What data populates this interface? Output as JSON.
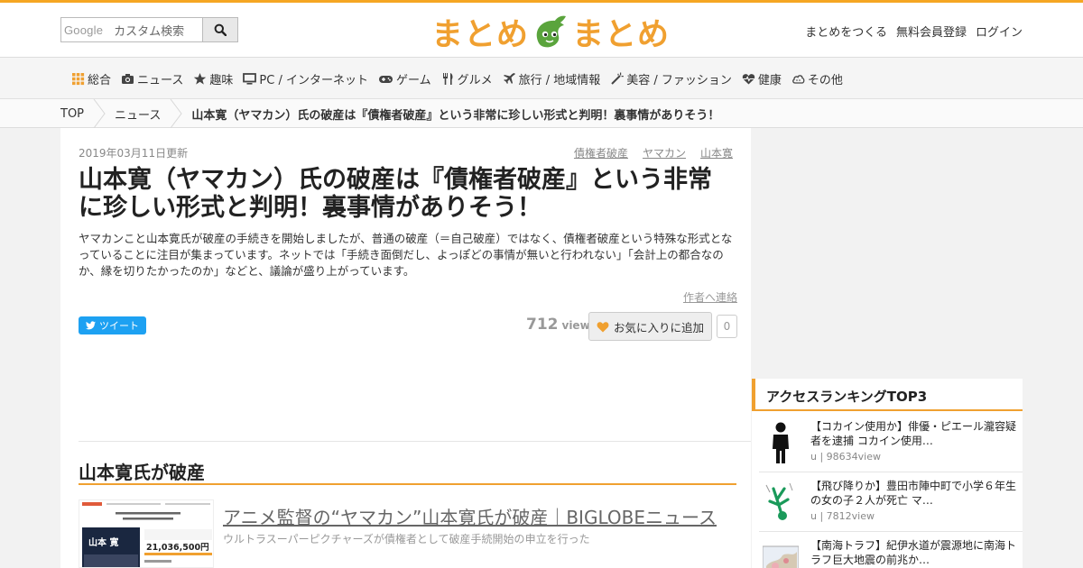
{
  "header": {
    "search_brand": "Google",
    "search_placeholder": "カスタム検索",
    "logo_left": "まとめ",
    "logo_right": "まとめ",
    "links": [
      "まとめをつくる",
      "無料会員登録",
      "ログイン"
    ]
  },
  "nav": [
    {
      "label": "総合",
      "icon": "grid-icon"
    },
    {
      "label": "ニュース",
      "icon": "camera-icon"
    },
    {
      "label": "趣味",
      "icon": "star-icon"
    },
    {
      "label": "PC / インターネット",
      "icon": "monitor-icon"
    },
    {
      "label": "ゲーム",
      "icon": "gamepad-icon"
    },
    {
      "label": "グルメ",
      "icon": "cutlery-icon"
    },
    {
      "label": "旅行 / 地域情報",
      "icon": "plane-icon"
    },
    {
      "label": "美容 / ファッション",
      "icon": "wand-icon"
    },
    {
      "label": "健康",
      "icon": "heartbeat-icon"
    },
    {
      "label": "その他",
      "icon": "cloud-icon"
    }
  ],
  "breadcrumb": {
    "top": "TOP",
    "category": "ニュース",
    "current": "山本寛（ヤマカン）氏の破産は『債権者破産』という非常に珍しい形式と判明！裏事情がありそう！"
  },
  "article": {
    "date": "2019年03月11日更新",
    "tags": [
      "債権者破産",
      "ヤマカン",
      "山本寛"
    ],
    "title": "山本寛（ヤマカン）氏の破産は『債権者破産』という非常に珍しい形式と判明！裏事情がありそう！",
    "description": "ヤマカンこと山本寛氏が破産の手続きを開始しましたが、普通の破産（＝自己破産）ではなく、債権者破産という特殊な形式となっていることに注目が集まっています。ネットでは「手続き面倒だし、よっぽどの事情が無いと行われない」「会計上の都合なのか、縁を切りたかったのか」などと、議論が盛り上がっています。",
    "contact": "作者へ連絡",
    "tweet": "ツイート",
    "views": "712",
    "views_label": "view",
    "fav_label": "お気に入りに追加",
    "fav_count": "0",
    "section_heading": "山本寛氏が破産",
    "link_title": "アニメ監督の“ヤマカン”山本寛氏が破産｜BIGLOBEニュース",
    "link_desc": "ウルトラスーパーピクチャーズが債権者として破産手続開始の申立を行った",
    "thumb": {
      "name": "山本 寛",
      "amount": "21,036,500円"
    }
  },
  "ranking": {
    "heading": "アクセスランキングTOP3",
    "items": [
      {
        "title": "【コカイン使用か】俳優・ピエール瀧容疑者を逮捕 コカイン使用…",
        "meta": "u | 98634view"
      },
      {
        "title": "【飛び降りか】豊田市陣中町で小学６年生の女の子２人が死亡 マ…",
        "meta": "u | 7812view"
      },
      {
        "title": "【南海トラフ】紀伊水道が震源地に南海トラフ巨大地震の前兆か…",
        "meta": ""
      }
    ]
  }
}
